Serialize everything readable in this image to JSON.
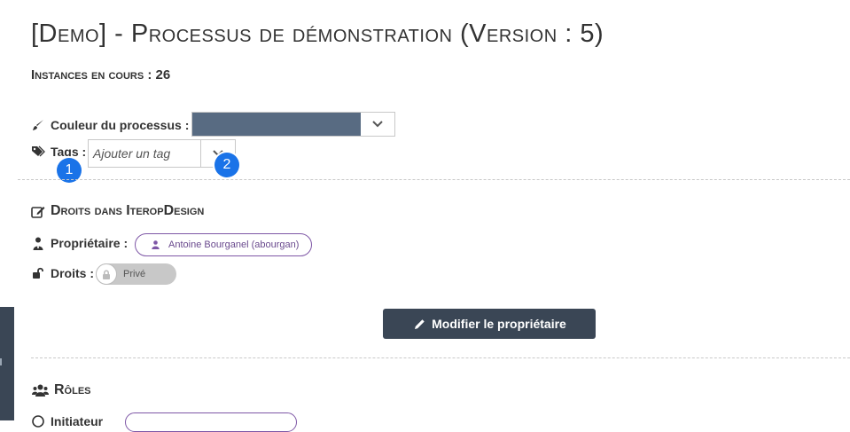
{
  "page": {
    "title": "[Demo] - Processus de démonstration (Version : 5)",
    "instances_label": "Instances en cours : 26"
  },
  "process": {
    "color_label": "Couleur du processus :",
    "color_value": "#586b82",
    "tags_label": "Tags :",
    "tags_placeholder": "Ajouter un tag"
  },
  "markers": {
    "one": "1",
    "two": "2"
  },
  "rights": {
    "section_title": "Droits dans IteropDesign",
    "owner_label": "Propriétaire :",
    "owner_name": "Antoine Bourganel (abourgan)",
    "rights_label": "Droits :",
    "rights_toggle": "Privé",
    "modify_button": "Modifier le propriétaire"
  },
  "roles": {
    "section_title": "Rôles",
    "initiator_label": "Initiateur"
  },
  "icons": [
    "paintbrush-icon",
    "tags-icon",
    "edit-icon",
    "user-tie-icon",
    "unlock-icon",
    "lock-icon",
    "pencil-icon",
    "users-icon",
    "chevron-down-icon"
  ]
}
